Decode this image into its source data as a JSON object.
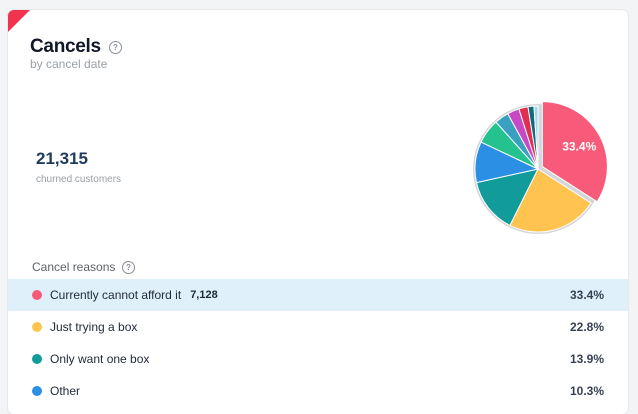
{
  "card": {
    "title": "Cancels",
    "subtitle": "by cancel date",
    "help_icon": "question-circle-icon"
  },
  "metric": {
    "value": "21,315",
    "label": "churned customers"
  },
  "chart_data": {
    "type": "pie",
    "title": "",
    "highlighted_label": "33.4%",
    "slices": [
      {
        "label": "Currently cannot afford it",
        "value": 33.4,
        "color": "#f85b79"
      },
      {
        "label": "Just trying a box",
        "value": 22.8,
        "color": "#fec44f"
      },
      {
        "label": "Only want one box",
        "value": 13.9,
        "color": "#119b9a"
      },
      {
        "label": "Other",
        "value": 10.3,
        "color": "#2b8fe4"
      },
      {
        "label": "",
        "value": 6.2,
        "color": "#23c28f"
      },
      {
        "label": "",
        "value": 3.6,
        "color": "#3aa0c2"
      },
      {
        "label": "",
        "value": 3.0,
        "color": "#c74ac4"
      },
      {
        "label": "",
        "value": 2.3,
        "color": "#e0304f"
      },
      {
        "label": "",
        "value": 1.5,
        "color": "#14687c"
      },
      {
        "label": "",
        "value": 1.0,
        "color": "#9bd8f0"
      }
    ]
  },
  "reasons": {
    "section_label": "Cancel reasons",
    "items": [
      {
        "label": "Currently cannot afford it",
        "count": "7,128",
        "pct": "33.4%",
        "color": "#f85b79"
      },
      {
        "label": "Just trying a box",
        "count": "",
        "pct": "22.8%",
        "color": "#fec44f"
      },
      {
        "label": "Only want one box",
        "count": "",
        "pct": "13.9%",
        "color": "#119b9a"
      },
      {
        "label": "Other",
        "count": "",
        "pct": "10.3%",
        "color": "#2b8fe4"
      }
    ]
  }
}
